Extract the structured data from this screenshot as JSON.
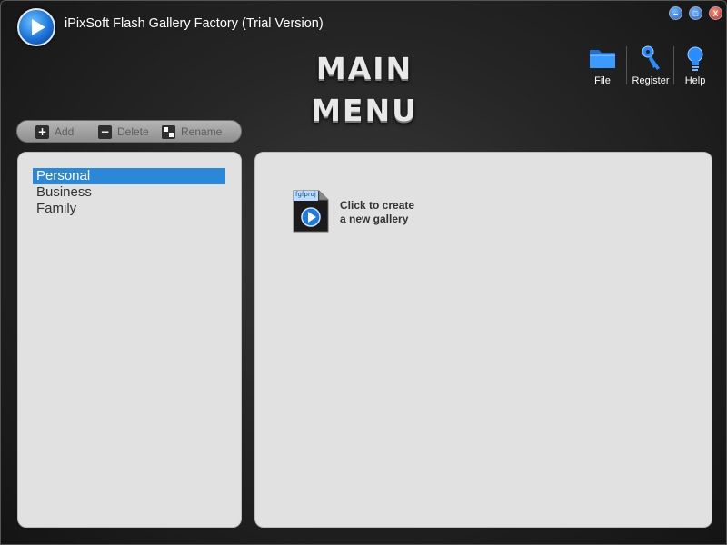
{
  "window": {
    "title": "iPixSoft Flash Gallery Factory (Trial Version)",
    "minimize_label": "–",
    "maximize_label": "□",
    "close_label": "X"
  },
  "heading": "MAIN MENU",
  "toolbar": {
    "file_label": "File",
    "register_label": "Register",
    "help_label": "Help"
  },
  "actions": {
    "add_label": "Add",
    "add_icon": "+",
    "delete_label": "Delete",
    "delete_icon": "−",
    "rename_label": "Rename"
  },
  "categories": [
    {
      "label": "Personal",
      "selected": true
    },
    {
      "label": "Business",
      "selected": false
    },
    {
      "label": "Family",
      "selected": false
    }
  ],
  "gallery": {
    "new_gallery_line1": "Click to create",
    "new_gallery_line2": "a new gallery",
    "file_tag": "fgfproj"
  },
  "colors": {
    "selection": "#2b88d8",
    "panel": "#e1e1e1",
    "accent": "#1a73d9"
  }
}
